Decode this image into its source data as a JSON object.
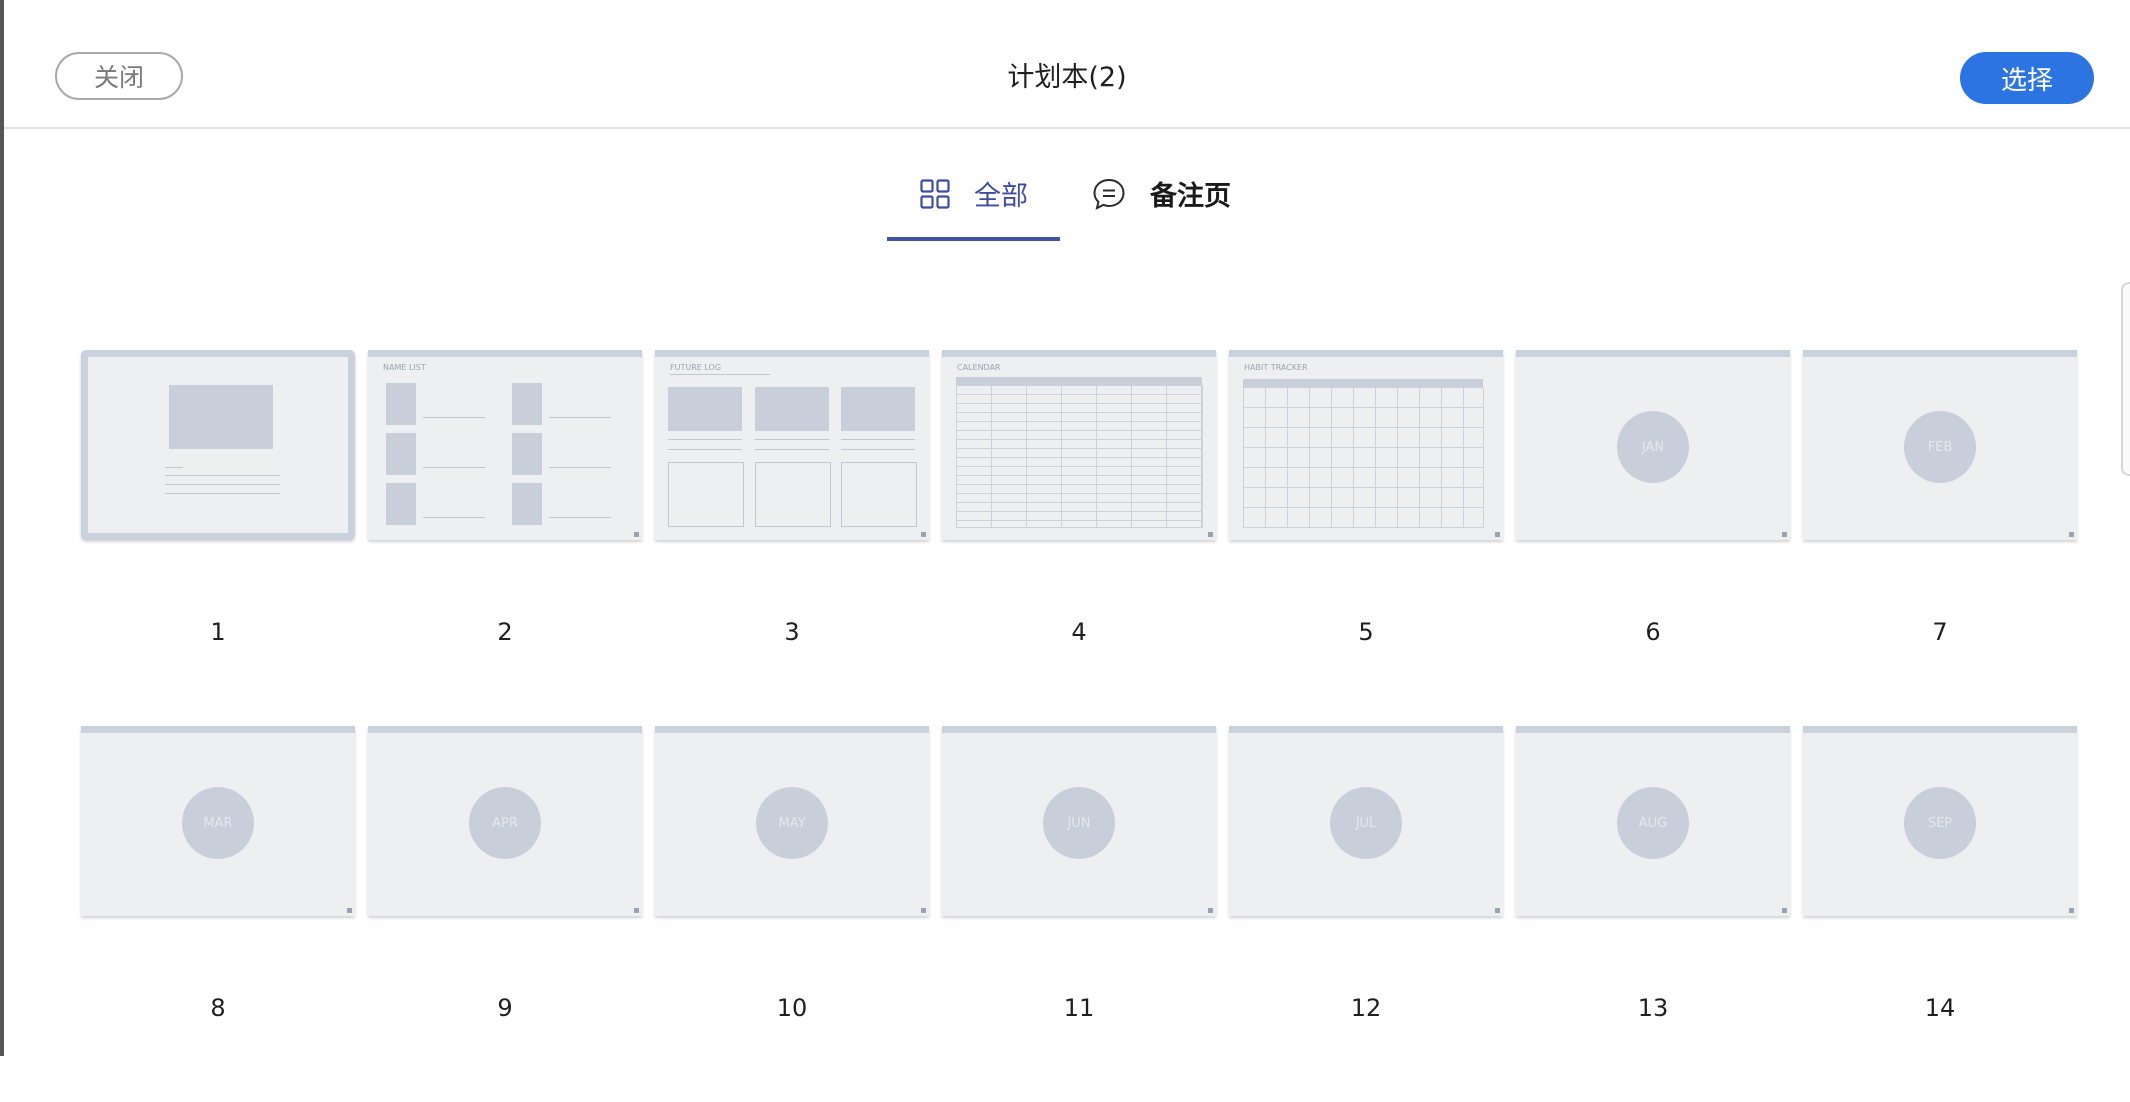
{
  "header": {
    "close_label": "关闭",
    "title": "计划本(2)",
    "select_label": "选择"
  },
  "tabs": [
    {
      "label": "全部",
      "icon": "grid-icon",
      "active": true
    },
    {
      "label": "备注页",
      "icon": "comment-icon",
      "active": false
    }
  ],
  "colors": {
    "accent": "#2b74e2",
    "tab_active": "#3d4ca1",
    "thumb_bg": "#eeeff1",
    "thumb_accent": "#c8ceda"
  },
  "pages": [
    {
      "number": "1"
    },
    {
      "number": "2",
      "title": "NAME LIST"
    },
    {
      "number": "3",
      "title": "FUTURE LOG"
    },
    {
      "number": "4",
      "title": "CALENDAR"
    },
    {
      "number": "5",
      "title": "HABIT TRACKER"
    },
    {
      "number": "6",
      "circle": "JAN"
    },
    {
      "number": "7",
      "circle": "FEB"
    },
    {
      "number": "8",
      "circle": "MAR"
    },
    {
      "number": "9",
      "circle": "APR"
    },
    {
      "number": "10",
      "circle": "MAY"
    },
    {
      "number": "11",
      "circle": "JUN"
    },
    {
      "number": "12",
      "circle": "JUL"
    },
    {
      "number": "13",
      "circle": "AUG"
    },
    {
      "number": "14",
      "circle": "SEP"
    }
  ]
}
